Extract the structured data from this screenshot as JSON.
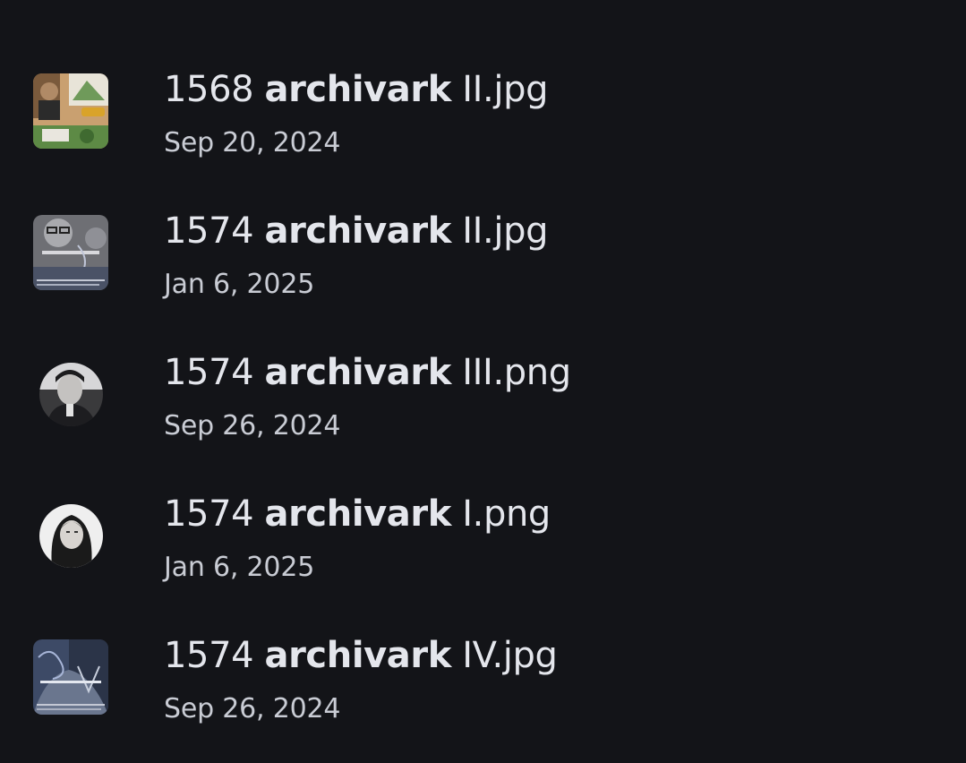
{
  "files": [
    {
      "prefix": "1568 ",
      "query": "archivark",
      "suffix": " II.jpg",
      "date": "Sep 20, 2024",
      "thumbnail": "collage-photo"
    },
    {
      "prefix": "1574 ",
      "query": "archivark",
      "suffix": " II.jpg",
      "date": "Jan 6, 2025",
      "thumbnail": "monochrome-poster"
    },
    {
      "prefix": "1574 ",
      "query": "archivark",
      "suffix": " III.png",
      "date": "Sep 26, 2024",
      "thumbnail": "round-portrait"
    },
    {
      "prefix": "1574 ",
      "query": "archivark",
      "suffix": " I.png",
      "date": "Jan 6, 2025",
      "thumbnail": "round-portrait"
    },
    {
      "prefix": "1574 ",
      "query": "archivark",
      "suffix": " IV.jpg",
      "date": "Sep 26, 2024",
      "thumbnail": "blue-poster"
    }
  ],
  "colors": {
    "background": "#131418",
    "title_text": "#e4e6ec",
    "date_text": "#c9ccd4"
  }
}
